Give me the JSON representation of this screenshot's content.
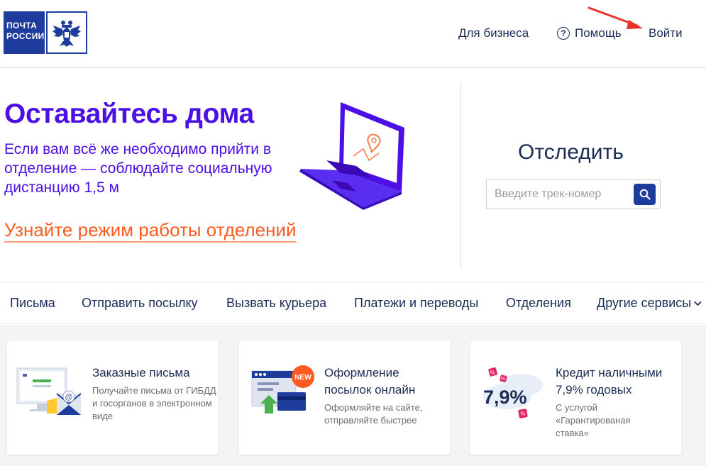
{
  "header": {
    "logo_line1": "ПОЧТА",
    "logo_line2": "РОССИИ",
    "nav_business": "Для бизнеса",
    "nav_help_icon": "?",
    "nav_help": "Помощь",
    "nav_login": "Войти"
  },
  "hero": {
    "title": "Оставайтесь дома",
    "text": "Если вам всё же необходимо прийти в отделение — соблюдайте социальную дистанцию 1,5 м",
    "link": "Узнайте режим работы отделений"
  },
  "tracking": {
    "title": "Отследить",
    "placeholder": "Введите трек-номер",
    "value": ""
  },
  "menu": {
    "items": [
      "Письма",
      "Отправить посылку",
      "Вызвать курьера",
      "Платежи и переводы",
      "Отделения",
      "Другие сервисы"
    ]
  },
  "cards": [
    {
      "icon": "registered-mail-icon",
      "title": "Заказные письма",
      "subtitle": "Получайте письма от ГИБДД и госорганов в электронном виде"
    },
    {
      "icon": "online-parcel-icon",
      "badge": "NEW",
      "title": "Оформление посылок онлайн",
      "subtitle": "Оформляйте на сайте, отправляйте быстрее"
    },
    {
      "icon": "credit-rate-icon",
      "rate": "7,9%",
      "title": "Кредит наличными",
      "rate_text": "7,9% годовых",
      "subtitle": "С услугой «Гарантированая ставка»"
    }
  ],
  "colors": {
    "brand_blue": "#1d3c9c",
    "hero_purple": "#4c10e6",
    "link_orange": "#ff5a1f",
    "arrow_red": "#e8332a"
  }
}
